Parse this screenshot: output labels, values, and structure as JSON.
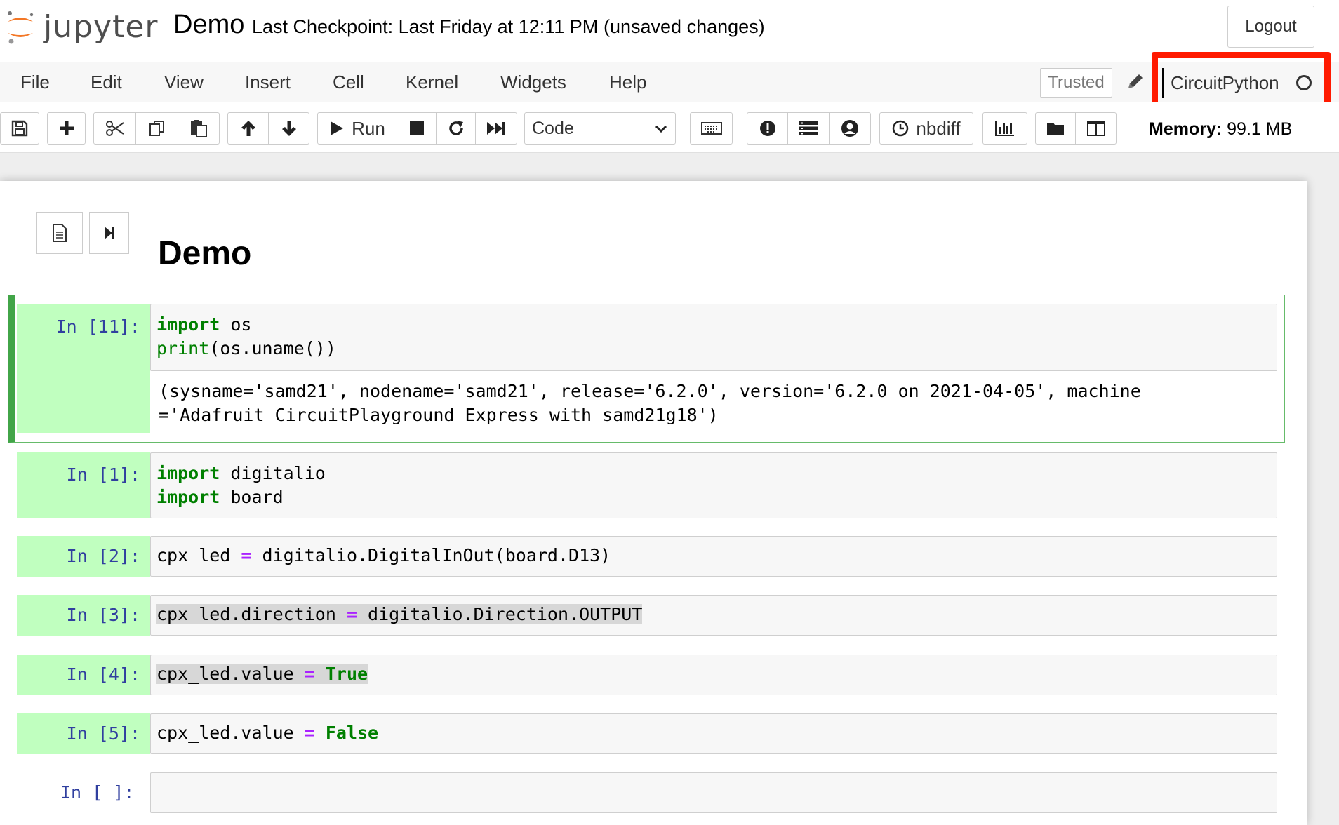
{
  "header": {
    "logo_text": "jupyter",
    "notebook_title": "Demo",
    "checkpoint": "Last Checkpoint: Last Friday at 12:11 PM",
    "autosave_status": "(unsaved changes)",
    "logout_label": "Logout"
  },
  "menubar": {
    "items": [
      "File",
      "Edit",
      "View",
      "Insert",
      "Cell",
      "Kernel",
      "Widgets",
      "Help"
    ],
    "trusted_label": "Trusted",
    "kernel_name": "CircuitPython"
  },
  "toolbar": {
    "run_label": "Run",
    "cell_type": "Code",
    "nbdiff_label": "nbdiff",
    "memory_label": "Memory:",
    "memory_value": "99.1 MB"
  },
  "notebook": {
    "markdown_heading": "Demo",
    "cells": [
      {
        "prompt": "In [11]:",
        "input_lines": [
          "import os",
          "print(os.uname())"
        ],
        "output_lines": [
          "(sysname='samd21', nodename='samd21', release='6.2.0', version='6.2.0 on 2021-04-05', machine",
          "='Adafruit CircuitPlayground Express with samd21g18')"
        ]
      },
      {
        "prompt": "In [1]:",
        "input_lines": [
          "import digitalio",
          "import board"
        ]
      },
      {
        "prompt": "In [2]:",
        "input_lines": [
          "cpx_led = digitalio.DigitalInOut(board.D13)"
        ]
      },
      {
        "prompt": "In [3]:",
        "input_lines": [
          "cpx_led.direction = digitalio.Direction.OUTPUT"
        ]
      },
      {
        "prompt": "In [4]:",
        "input_lines": [
          "cpx_led.value = True"
        ]
      },
      {
        "prompt": "In [5]:",
        "input_lines": [
          "cpx_led.value = False"
        ]
      },
      {
        "prompt": "In [ ]:",
        "input_lines": [
          ""
        ]
      }
    ]
  },
  "colors": {
    "kernel_highlight": "#ff1a00",
    "prompt_bg": "#c0ffbf",
    "prompt_text": "#303f9f",
    "keyword": "#008000",
    "operator": "#aa22ff",
    "logo_orange": "#f37726"
  },
  "icons": [
    "save-icon",
    "plus-icon",
    "cut-icon",
    "copy-icon",
    "paste-icon",
    "arrow-up-icon",
    "arrow-down-icon",
    "play-icon",
    "stop-icon",
    "restart-icon",
    "fast-forward-icon",
    "keyboard-icon",
    "exclamation-icon",
    "list-icon",
    "user-circle-icon",
    "clock-icon",
    "bar-chart-icon",
    "folder-icon",
    "columns-icon",
    "pencil-icon",
    "file-text-icon",
    "step-forward-icon"
  ]
}
